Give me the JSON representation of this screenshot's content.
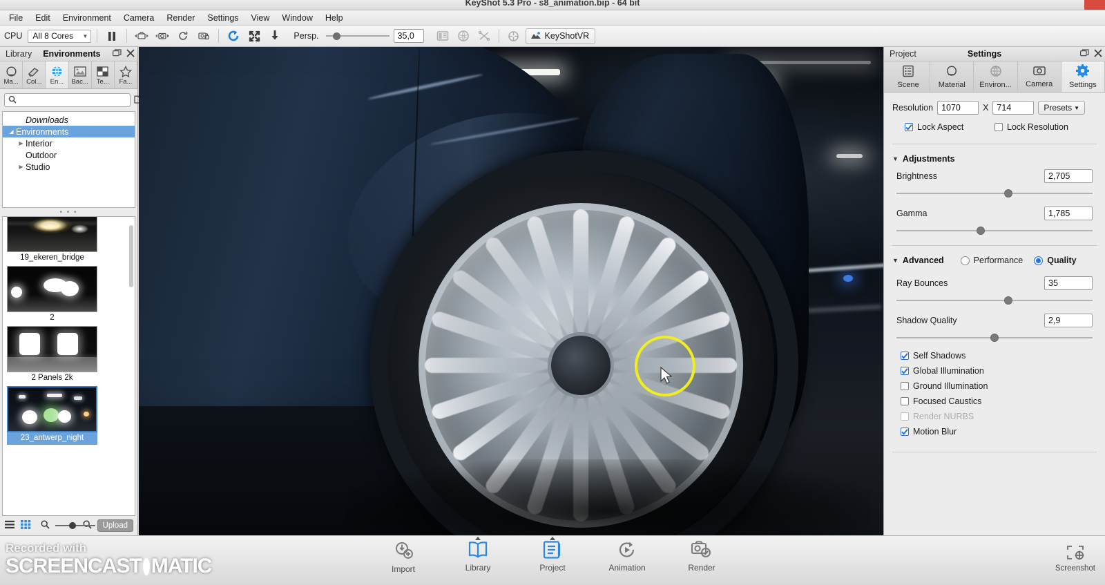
{
  "window": {
    "title": "KeyShot 5.3 Pro  -  s8_animation.bip  -  64 bit"
  },
  "menubar": {
    "items": [
      "File",
      "Edit",
      "Environment",
      "Camera",
      "Render",
      "Settings",
      "View",
      "Window",
      "Help"
    ]
  },
  "toolbar": {
    "cpu_label": "CPU",
    "cores_value": "All 8 Cores",
    "perspective_label": "Persp.",
    "focal_value": "35,0",
    "keyshotvr_label": "KeyShotVR",
    "icons": [
      "pause-icon",
      "move-camera-icon",
      "camera-icon",
      "refresh-icon",
      "lock-camera-icon",
      "reset-icon",
      "fit-icon",
      "download-icon",
      "image-styles-icon",
      "materials-icon",
      "nurbs-icon",
      "region-icon"
    ]
  },
  "library": {
    "tab_library": "Library",
    "tab_environments": "Environments",
    "tabs": [
      {
        "label": "Ma...",
        "icon": "material-sphere-icon"
      },
      {
        "label": "Col...",
        "icon": "color-swatch-icon"
      },
      {
        "label": "En...",
        "icon": "globe-icon"
      },
      {
        "label": "Bac...",
        "icon": "image-icon"
      },
      {
        "label": "Te...",
        "icon": "texture-icon"
      },
      {
        "label": "Fa...",
        "icon": "star-icon"
      }
    ],
    "active_tab_index": 2,
    "search_placeholder": "",
    "search_value": "",
    "folder_icons": [
      "add-folder-icon",
      "open-folder-icon"
    ],
    "tree": [
      {
        "label": "Downloads",
        "indent": 1,
        "twisty": "",
        "italic": true,
        "selected": false
      },
      {
        "label": "Environments",
        "indent": 0,
        "twisty": "◢",
        "italic": false,
        "selected": true
      },
      {
        "label": "Interior",
        "indent": 1,
        "twisty": "▶",
        "italic": false,
        "selected": false
      },
      {
        "label": "Outdoor",
        "indent": 1,
        "twisty": "",
        "italic": false,
        "selected": false
      },
      {
        "label": "Studio",
        "indent": 1,
        "twisty": "▶",
        "italic": false,
        "selected": false
      }
    ],
    "thumbnails": [
      {
        "name": "19_ekeren_bridge",
        "selected": false,
        "style": "bridge"
      },
      {
        "name": "2",
        "selected": false,
        "style": "two"
      },
      {
        "name": "2 Panels 2k",
        "selected": false,
        "style": "panels"
      },
      {
        "name": "23_antwerp_night",
        "selected": true,
        "style": "antwerp"
      }
    ],
    "footer": {
      "list_view_icon": "list-view-icon",
      "grid_view_icon": "grid-view-icon",
      "zoom_out_icon": "zoom-out-icon",
      "zoom_in_icon": "zoom-in-icon",
      "upload_label": "Upload"
    }
  },
  "project": {
    "tab_project": "Project",
    "tab_settings": "Settings",
    "tabs": [
      {
        "label": "Scene",
        "icon": "scene-tree-icon"
      },
      {
        "label": "Material",
        "icon": "material-sphere-icon"
      },
      {
        "label": "Environ...",
        "icon": "globe-icon"
      },
      {
        "label": "Camera",
        "icon": "camera-icon"
      },
      {
        "label": "Settings",
        "icon": "gear-icon"
      }
    ],
    "active_tab_index": 4,
    "resolution": {
      "label": "Resolution",
      "width": "1070",
      "separator": "X",
      "height": "714",
      "presets_label": "Presets"
    },
    "lock_aspect": {
      "label": "Lock Aspect",
      "checked": true
    },
    "lock_resolution": {
      "label": "Lock Resolution",
      "checked": false
    },
    "adjustments": {
      "title": "Adjustments",
      "expanded": true,
      "brightness": {
        "label": "Brightness",
        "value": "2,705",
        "slider_pct": 57
      },
      "gamma": {
        "label": "Gamma",
        "value": "1,785",
        "slider_pct": 43
      }
    },
    "advanced": {
      "title": "Advanced",
      "expanded": true,
      "mode_performance": {
        "label": "Performance",
        "selected": false
      },
      "mode_quality": {
        "label": "Quality",
        "selected": true
      },
      "ray_bounces": {
        "label": "Ray Bounces",
        "value": "35",
        "slider_pct": 57
      },
      "shadow_quality": {
        "label": "Shadow Quality",
        "value": "2,9",
        "slider_pct": 50
      },
      "checkboxes": [
        {
          "label": "Self Shadows",
          "checked": true,
          "disabled": false
        },
        {
          "label": "Global Illumination",
          "checked": true,
          "disabled": false
        },
        {
          "label": "Ground Illumination",
          "checked": false,
          "disabled": false
        },
        {
          "label": "Focused Caustics",
          "checked": false,
          "disabled": false
        },
        {
          "label": "Render NURBS",
          "checked": false,
          "disabled": true
        },
        {
          "label": "Motion Blur",
          "checked": true,
          "disabled": false
        }
      ]
    }
  },
  "bottom_nav": {
    "items": [
      {
        "label": "Import",
        "icon": "import-icon",
        "active": false,
        "marker": false
      },
      {
        "label": "Library",
        "icon": "book-icon",
        "active": true,
        "marker": true
      },
      {
        "label": "Project",
        "icon": "project-icon",
        "active": true,
        "marker": true
      },
      {
        "label": "Animation",
        "icon": "animation-icon",
        "active": false,
        "marker": false
      },
      {
        "label": "Render",
        "icon": "render-camera-icon",
        "active": false,
        "marker": false
      }
    ],
    "screenshot": {
      "label": "Screenshot",
      "icon": "screenshot-target-icon"
    }
  },
  "watermark": {
    "line1": "Recorded with",
    "line2a": "SCREENCAST",
    "line2b": "MATIC"
  },
  "colors": {
    "accent_blue": "#1f72e8",
    "selection_blue": "#6ba3dd",
    "cursor_ring_yellow": "#f0ee20",
    "close_red": "#d94a3e",
    "panel_gray": "#ececec",
    "car_blue": "#1b2a3c"
  }
}
